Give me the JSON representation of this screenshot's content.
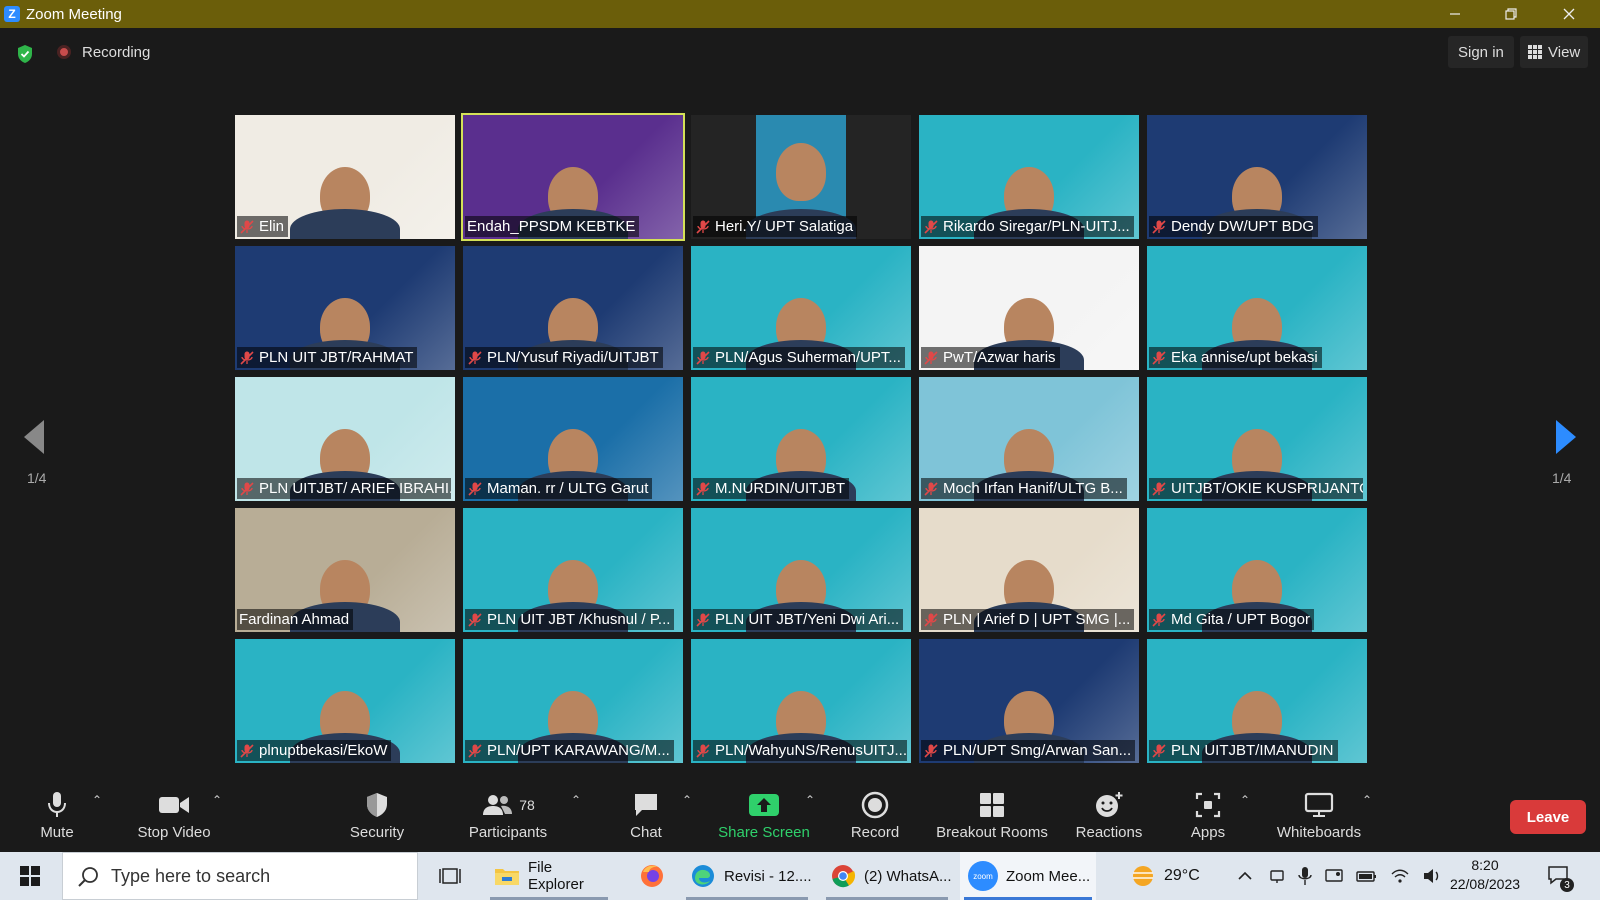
{
  "window": {
    "title": "Zoom Meeting",
    "app_logo_letter": "Z"
  },
  "topbar": {
    "recording_label": "Recording",
    "sign_in_label": "Sign in",
    "view_label": "View"
  },
  "pagination": {
    "left_page": "1/4",
    "right_page": "1/4"
  },
  "participants_tiles": [
    {
      "name": "Elin",
      "muted": true,
      "active": false,
      "bg": "#f0ece4"
    },
    {
      "name": "Endah_PPSDM KEBTKE",
      "muted": false,
      "active": true,
      "bg": "#5a2f8e"
    },
    {
      "name": "Heri.Y/ UPT Salatiga",
      "muted": true,
      "active": false,
      "bg": "#242424"
    },
    {
      "name": "Rikardo Siregar/PLN-UITJ...",
      "muted": true,
      "active": false,
      "bg": "#2ab3c4"
    },
    {
      "name": "Dendy DW/UPT BDG",
      "muted": true,
      "active": false,
      "bg": "#1e3b73"
    },
    {
      "name": "PLN UIT JBT/RAHMAT",
      "muted": true,
      "active": false,
      "bg": "#1e3b73"
    },
    {
      "name": "PLN/Yusuf Riyadi/UITJBT",
      "muted": true,
      "active": false,
      "bg": "#1e3b73"
    },
    {
      "name": "PLN/Agus Suherman/UPT...",
      "muted": true,
      "active": false,
      "bg": "#2ab3c4"
    },
    {
      "name": "PwT/Azwar haris",
      "muted": true,
      "active": false,
      "bg": "#f4f4f4"
    },
    {
      "name": "Eka annise/upt bekasi",
      "muted": true,
      "active": false,
      "bg": "#2ab3c4"
    },
    {
      "name": "PLN UITJBT/ ARIEF IBRAHI...",
      "muted": true,
      "active": false,
      "bg": "#bfe5e8"
    },
    {
      "name": "Maman. rr / ULTG Garut",
      "muted": true,
      "active": false,
      "bg": "#1b6fa8"
    },
    {
      "name": "M.NURDIN/UITJBT",
      "muted": true,
      "active": false,
      "bg": "#2ab3c4"
    },
    {
      "name": "Moch Irfan Hanif/ULTG B...",
      "muted": true,
      "active": false,
      "bg": "#7fc4d8"
    },
    {
      "name": "UITJBT/OKIE KUSPRIJANTO",
      "muted": true,
      "active": false,
      "bg": "#2ab3c4"
    },
    {
      "name": "Fardinan Ahmad",
      "muted": false,
      "active": false,
      "bg": "#b8ad96"
    },
    {
      "name": "PLN UIT JBT /Khusnul / P...",
      "muted": true,
      "active": false,
      "bg": "#2ab3c4"
    },
    {
      "name": "PLN UIT JBT/Yeni Dwi Ari...",
      "muted": true,
      "active": false,
      "bg": "#2ab3c4"
    },
    {
      "name": "PLN | Arief D | UPT SMG |...",
      "muted": true,
      "active": false,
      "bg": "#e6dccb"
    },
    {
      "name": "Md Gita / UPT Bogor",
      "muted": true,
      "active": false,
      "bg": "#2ab3c4"
    },
    {
      "name": "plnuptbekasi/EkoW",
      "muted": true,
      "active": false,
      "bg": "#2ab3c4"
    },
    {
      "name": "PLN/UPT KARAWANG/M...",
      "muted": true,
      "active": false,
      "bg": "#2ab3c4"
    },
    {
      "name": "PLN/WahyuNS/RenusUITJ...",
      "muted": true,
      "active": false,
      "bg": "#2ab3c4"
    },
    {
      "name": "PLN/UPT Smg/Arwan San...",
      "muted": true,
      "active": false,
      "bg": "#1e3b73"
    },
    {
      "name": "PLN UITJBT/IMANUDIN",
      "muted": true,
      "active": false,
      "bg": "#2ab3c4"
    }
  ],
  "toolbar": {
    "mute": "Mute",
    "stop_video": "Stop Video",
    "security": "Security",
    "participants": "Participants",
    "participants_count": "78",
    "chat": "Chat",
    "share_screen": "Share Screen",
    "record": "Record",
    "breakout_rooms": "Breakout Rooms",
    "reactions": "Reactions",
    "apps": "Apps",
    "whiteboards": "Whiteboards",
    "leave": "Leave"
  },
  "taskbar": {
    "search_placeholder": "Type here to search",
    "file_explorer": "File Explorer",
    "edge_tab": "Revisi - 12....",
    "chrome_tab": "(2) WhatsA...",
    "zoom_tab": "Zoom Mee...",
    "zoom_icon_text": "zoom",
    "weather": "29°C",
    "time": "8:20",
    "date": "22/08/2023",
    "notifications": "3"
  },
  "colors": {
    "titlebar": "#6b5e0a",
    "accent_blue": "#2d8cff",
    "share_green": "#2fd06b",
    "leave_red": "#d93a3a",
    "active_speaker": "#d4e157"
  }
}
